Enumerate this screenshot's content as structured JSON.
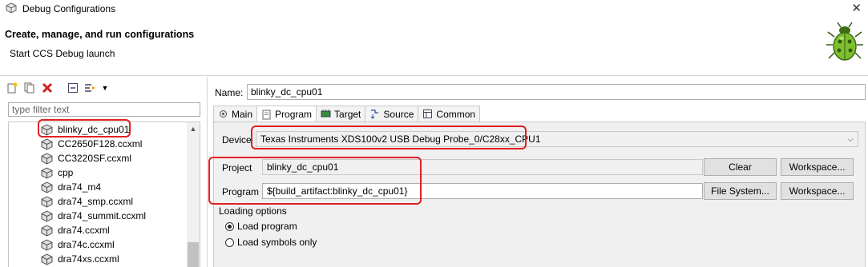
{
  "window": {
    "title": "Debug Configurations",
    "close_glyph": "✕"
  },
  "header": {
    "title": "Create, manage, and run configurations",
    "subtitle": "Start CCS Debug launch"
  },
  "left": {
    "toolbar_icons": [
      "new-config-icon",
      "duplicate-icon",
      "delete-icon",
      "collapse-all-icon",
      "filter-icon"
    ],
    "filter_placeholder": "type filter text",
    "items": [
      {
        "label": "blinky_dc_cpu01"
      },
      {
        "label": "CC2650F128.ccxml"
      },
      {
        "label": "CC3220SF.ccxml"
      },
      {
        "label": "cpp"
      },
      {
        "label": "dra74_m4"
      },
      {
        "label": "dra74_smp.ccxml"
      },
      {
        "label": "dra74_summit.ccxml"
      },
      {
        "label": "dra74.ccxml"
      },
      {
        "label": "dra74c.ccxml"
      },
      {
        "label": "dra74xs.ccxml"
      }
    ]
  },
  "right": {
    "name_label": "Name:",
    "name_value": "blinky_dc_cpu01",
    "tabs": [
      {
        "label": "Main",
        "icon": "gear-icon"
      },
      {
        "label": "Program",
        "icon": "document-icon"
      },
      {
        "label": "Target",
        "icon": "chip-icon"
      },
      {
        "label": "Source",
        "icon": "source-icon"
      },
      {
        "label": "Common",
        "icon": "common-icon"
      }
    ],
    "selected_tab": "Program",
    "device_label": "Device",
    "device_value": "Texas Instruments XDS100v2 USB Debug Probe_0/C28xx_CPU1",
    "project_label": "Project",
    "project_value": "blinky_dc_cpu01",
    "program_label": "Program",
    "program_value": "${build_artifact:blinky_dc_cpu01}",
    "clear_button": "Clear",
    "workspace_button_1": "Workspace...",
    "filesystem_button": "File System...",
    "workspace_button_2": "Workspace...",
    "loading_options_label": "Loading options",
    "load_program_label": "Load program",
    "load_symbols_label": "Load symbols only",
    "loading_selected": "Load program"
  },
  "colors": {
    "highlight": "#e02020",
    "panel_bg": "#f0f0f0"
  }
}
